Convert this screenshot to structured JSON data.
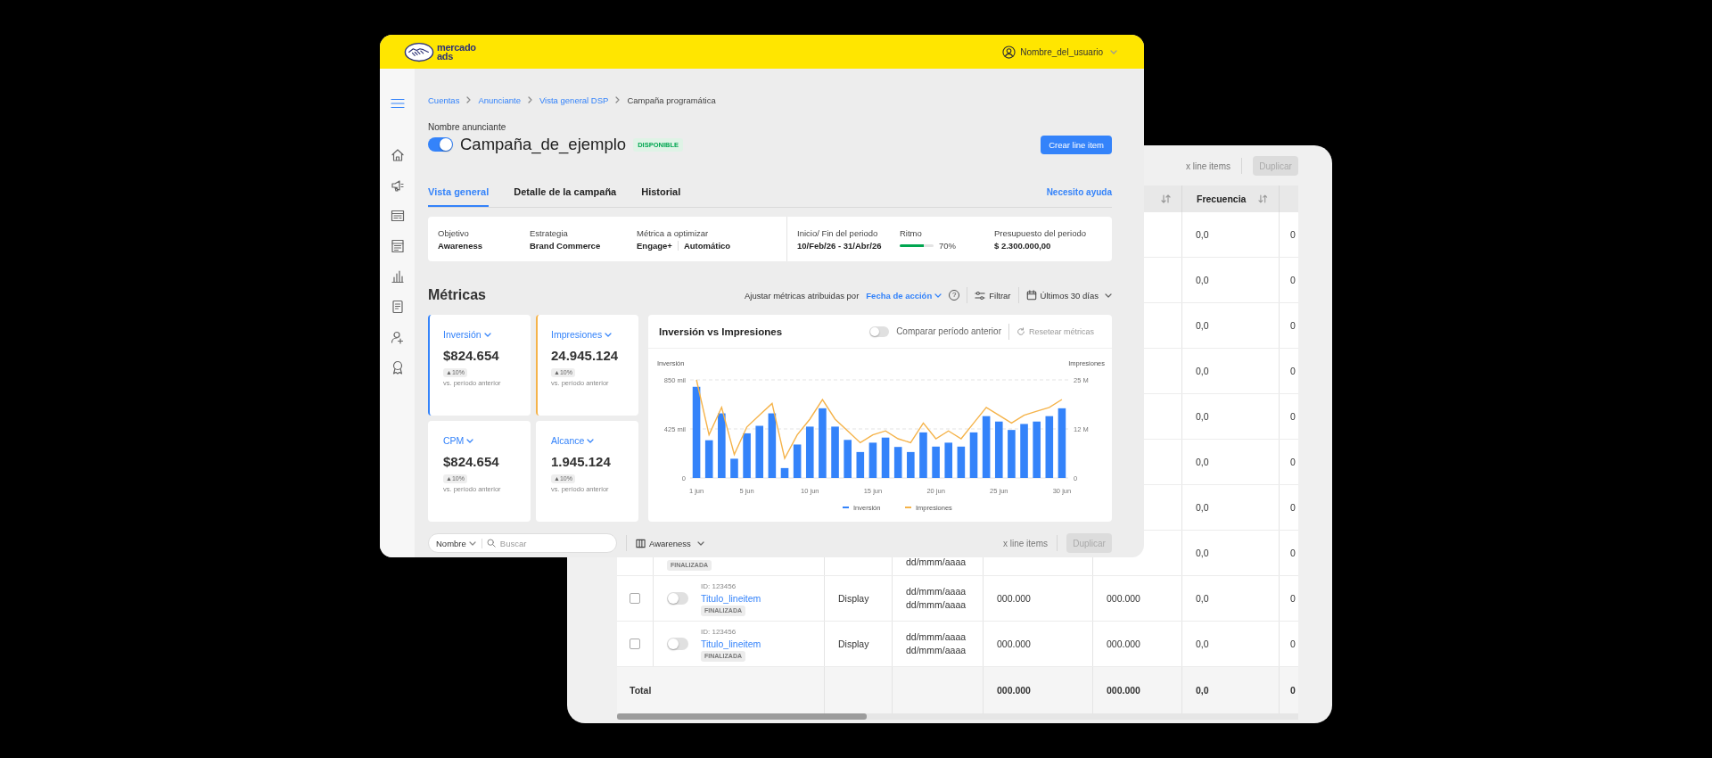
{
  "back_window": {
    "toolbar": {
      "count": "x line items",
      "duplicate_button": {
        "label": "Duplicar",
        "disabled": true
      }
    },
    "table": {
      "header": {
        "column_6": {
          "sortable": true
        },
        "frecuencia": {
          "label": "Frecuencia",
          "sortable": true
        }
      },
      "rows": [
        {
          "frecuencia": "0,0",
          "column_8": "0"
        },
        {
          "frecuencia": "0,0",
          "column_8": "0"
        },
        {
          "frecuencia": "0,0",
          "column_8": "0"
        },
        {
          "frecuencia": "0,0",
          "column_8": "0"
        },
        {
          "frecuencia": "0,0",
          "column_8": "0"
        },
        {
          "frecuencia": "0,0",
          "column_8": "0"
        },
        {
          "frecuencia": "0,0",
          "column_8": "0"
        },
        {
          "status": "FINALIZADA",
          "date_end": "dd/mmm/aaaa",
          "frecuencia": "0,0",
          "column_8": "0"
        },
        {
          "checked": false,
          "on": false,
          "id": "ID: 123456",
          "title": "Titulo_lineitem",
          "status": "FINALIZADA",
          "type": "Display",
          "date_start": "dd/mmm/aaaa",
          "date_end": "dd/mmm/aaaa",
          "column_5": "000.000",
          "column_6": "000.000",
          "frecuencia": "0,0",
          "column_8": "0"
        },
        {
          "checked": false,
          "on": false,
          "id": "ID: 123456",
          "title": "Titulo_lineitem",
          "status": "FINALIZADA",
          "type": "Display",
          "date_start": "dd/mmm/aaaa",
          "date_end": "dd/mmm/aaaa",
          "column_5": "000.000",
          "column_6": "000.000",
          "frecuencia": "0,0",
          "column_8": "0"
        }
      ],
      "total": {
        "label": "Total",
        "column_5": "000.000",
        "column_6": "000.000",
        "frecuencia": "0,0",
        "column_8": "0"
      }
    }
  },
  "front_window": {
    "header": {
      "logo_text": "mercado ads",
      "user_name": "Nombre_del_usuario"
    },
    "breadcrumbs": [
      {
        "label": "Cuentas",
        "kind": "link"
      },
      {
        "label": "Anunciante",
        "kind": "link"
      },
      {
        "label": "Vista general DSP",
        "kind": "link"
      },
      {
        "label": "Campaña programática",
        "kind": "current"
      }
    ],
    "advertiser_label": "Nombre anunciante",
    "campaign": {
      "title": "Campaña_de_ejemplo",
      "on": true,
      "status": "DISPONIBLE"
    },
    "create_button": "Crear line item",
    "tabs": [
      {
        "label": "Vista general",
        "selected": true
      },
      {
        "label": "Detalle de la campaña",
        "selected": false
      },
      {
        "label": "Historial",
        "selected": false
      }
    ],
    "help_link": "Necesito ayuda",
    "summary": [
      {
        "label": "Objetivo",
        "kind": "text",
        "value": "Awareness"
      },
      {
        "label": "Estrategia",
        "kind": "text",
        "value": "Brand Commerce"
      },
      {
        "label": "Métrica a optimizar",
        "kind": "pair",
        "values": [
          "Engage+",
          "Automático"
        ]
      },
      {
        "label": "Inicio/ Fin del periodo",
        "kind": "text",
        "value": "10/Feb/26 - 31/Abr/26"
      },
      {
        "label": "Ritmo",
        "kind": "meter",
        "level": 0.7,
        "reading": "70%"
      },
      {
        "label": "Presupuesto del periodo",
        "kind": "text",
        "value": "$ 2.300.000,00"
      }
    ],
    "metrics": {
      "title": "Métricas",
      "attribution_label": "Ajustar métricas atribuidas por",
      "attribution_value": "Fecha de acción",
      "help_symbol": "?",
      "filter_button": "Filtrar",
      "date_range": "Últimos 30 días",
      "cards": [
        {
          "title": "Inversión",
          "value": "$824.654",
          "change": "▲10%",
          "note": "vs. período anterior",
          "selected": true,
          "color": "#3483fa"
        },
        {
          "title": "Impresiones",
          "value": "24.945.124",
          "change": "▲10%",
          "note": "vs. período anterior",
          "selected": true,
          "color": "#f5b34a"
        },
        {
          "title": "CPM",
          "value": "$824.654",
          "change": "▲10%",
          "note": "vs. período anterior",
          "selected": false
        },
        {
          "title": "Alcance",
          "value": "1.945.124",
          "change": "▲10%",
          "note": "vs. período anterior",
          "selected": false
        }
      ],
      "chart_panel": {
        "title": "Inversión vs Impresiones",
        "compare_toggle": {
          "label": "Comparar período anterior",
          "on": false
        },
        "reset_button": {
          "label": "Resetear métricas",
          "disabled": true
        },
        "chart_data": {
          "type": "bar",
          "legend": "bottom",
          "ylabel": "Inversión",
          "y2label": "Impresiones",
          "categories": [
            "1 jun",
            null,
            null,
            null,
            "5 jun",
            null,
            null,
            null,
            null,
            "10 jun",
            null,
            null,
            null,
            null,
            "15 jun",
            null,
            null,
            null,
            null,
            "20 jun",
            null,
            null,
            null,
            null,
            "25 jun",
            null,
            null,
            null,
            null,
            "30 jun"
          ],
          "ylim": [
            0,
            850
          ],
          "yticks": [
            {
              "value": 0,
              "label": "0"
            },
            {
              "value": 425,
              "label": "425 mil"
            },
            {
              "value": 850,
              "label": "850 mil"
            }
          ],
          "y2lim": [
            0,
            25
          ],
          "y2ticks": [
            {
              "value": 0,
              "label": "0"
            },
            {
              "value": 12.5,
              "label": "12 M"
            },
            {
              "value": 25,
              "label": "25 M"
            }
          ],
          "series": [
            {
              "name": "Inversión",
              "color": "#3483fa",
              "values": [
                790,
                327,
                560,
                167,
                387,
                452,
                560,
                86,
                290,
                445,
                604,
                445,
                330,
                225,
                306,
                350,
                269,
                225,
                395,
                272,
                306,
                272,
                395,
                536,
                489,
                416,
                468,
                489,
                536,
                604
              ]
            },
            {
              "name": "Impresiones",
              "type": "line",
              "axis": "y2",
              "color": "#f5b34a",
              "values": [
                25,
                11,
                18,
                6,
                13,
                16,
                19,
                5,
                11,
                15,
                20,
                15,
                12,
                9,
                11,
                12,
                10,
                9,
                14,
                10,
                12,
                10,
                14,
                18,
                16,
                14,
                16,
                17,
                18,
                20
              ]
            }
          ]
        }
      }
    },
    "list_toolbar": {
      "search": {
        "filter": "Nombre",
        "placeholder": "Buscar"
      },
      "objective_filter": "Awareness",
      "count": "x line items",
      "duplicate_button": {
        "label": "Duplicar",
        "disabled": true
      }
    }
  }
}
